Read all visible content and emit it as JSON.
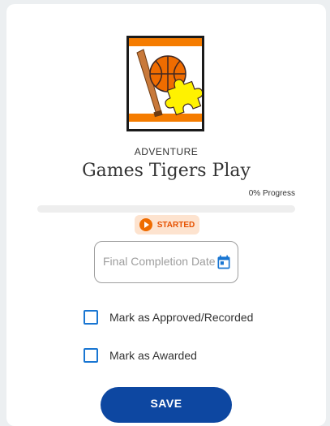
{
  "badge": {
    "category": "ADVENTURE",
    "title": "Games Tigers Play",
    "image_icon": "sports-puzzle-icon"
  },
  "progress": {
    "label": "0% Progress",
    "value": 0
  },
  "status": {
    "label": "STARTED",
    "icon": "play-circle-icon"
  },
  "completion_date": {
    "placeholder": "Final Completion Date",
    "value": "",
    "icon": "calendar-icon"
  },
  "checkboxes": [
    {
      "label": "Mark as Approved/Recorded",
      "checked": false
    },
    {
      "label": "Mark as Awarded",
      "checked": false
    }
  ],
  "save_button": {
    "label": "SAVE"
  },
  "colors": {
    "accent_orange": "#f57c00",
    "primary_blue": "#0d47a1",
    "checkbox_blue": "#1976d2"
  }
}
